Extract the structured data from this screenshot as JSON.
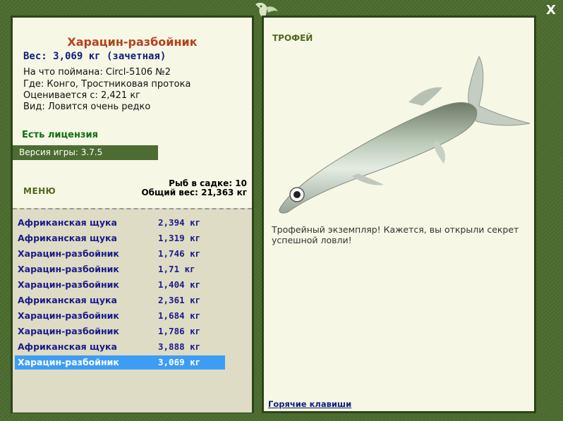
{
  "window": {
    "close_label": "X"
  },
  "fish": {
    "name": "Харацин-разбойник",
    "weight": "Вес: 3,069 кг (зачетная)",
    "bait": "На что поймана: Circl-5106 №2",
    "location": "Где: Конго, Тростниковая протока",
    "valued": "Оценивается с: 2,421 кг",
    "kind": "Вид: Ловится очень редко"
  },
  "license": "Есть лицензия",
  "version": "Версия игры: 3.7.5",
  "menu_label": "МЕНЮ",
  "stats": {
    "in_keepnet": "Рыб в садке: 10",
    "total_weight": "Общий вес: 21,363 кг"
  },
  "catch_list": [
    {
      "name": "Африканская щука",
      "weight": "2,394 кг"
    },
    {
      "name": "Африканская щука",
      "weight": "1,319 кг"
    },
    {
      "name": "Харацин-разбойник",
      "weight": "1,746 кг"
    },
    {
      "name": "Харацин-разбойник",
      "weight": "1,71 кг"
    },
    {
      "name": "Харацин-разбойник",
      "weight": "1,404 кг"
    },
    {
      "name": "Африканская щука",
      "weight": "2,361 кг"
    },
    {
      "name": "Харацин-разбойник",
      "weight": "1,684 кг"
    },
    {
      "name": "Харацин-разбойник",
      "weight": "1,786 кг"
    },
    {
      "name": "Африканская щука",
      "weight": "3,888 кг"
    },
    {
      "name": "Харацин-разбойник",
      "weight": "3,069 кг"
    }
  ],
  "trophy_label": "ТРОФЕЙ",
  "description": "Трофейный экземпляр! Кажется, вы открыли секрет успешной ловли!",
  "hotkeys_label": "Горячие клавиши",
  "colors": {
    "frame": "#4a6b2e",
    "panel": "#f7f7e6",
    "selection": "#3d9df5",
    "title": "#b5401d"
  }
}
